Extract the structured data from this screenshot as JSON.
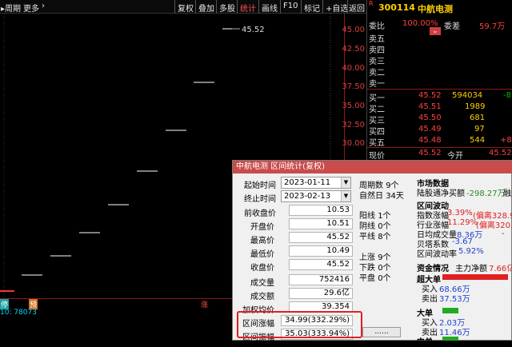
{
  "toolbar": {
    "left": [
      "周期",
      "更多",
      "›"
    ],
    "tabs": [
      "复权",
      "叠加",
      "多股",
      "统计",
      "画线",
      "F10",
      "标记",
      "+自选",
      "返回"
    ],
    "active_tab": "统计"
  },
  "chart": {
    "price_label": "45.52",
    "yticks": [
      "45.00",
      "42.50",
      "40.00",
      "37.50",
      "35.00",
      "32.50",
      "30.00"
    ],
    "markers": [
      "停",
      "预",
      "涨"
    ],
    "ma_text": "10: 78073"
  },
  "quote": {
    "code": "300114",
    "name": "中航电测",
    "r_badge": "R",
    "ratio_label": "委比",
    "ratio_value": "100.00%",
    "diff_label": "委差",
    "diff_value": "59.7万",
    "sell": [
      {
        "label": "卖五",
        "price": "",
        "vol": ""
      },
      {
        "label": "卖四",
        "price": "",
        "vol": ""
      },
      {
        "label": "卖三",
        "price": "",
        "vol": ""
      },
      {
        "label": "卖二",
        "price": "",
        "vol": ""
      },
      {
        "label": "卖一",
        "price": "",
        "vol": ""
      }
    ],
    "buy": [
      {
        "label": "买一",
        "price": "45.52",
        "vol": "594034",
        "extra": "-8"
      },
      {
        "label": "买二",
        "price": "45.51",
        "vol": "1989",
        "extra": ""
      },
      {
        "label": "买三",
        "price": "45.50",
        "vol": "681",
        "extra": ""
      },
      {
        "label": "买四",
        "price": "45.49",
        "vol": "97",
        "extra": ""
      },
      {
        "label": "买五",
        "price": "45.48",
        "vol": "544",
        "extra": "+8"
      }
    ],
    "now_label": "现价",
    "now_value": "45.52",
    "open_label": "今开",
    "open_value": "45.52"
  },
  "dialog": {
    "title": "中航电测 区间统计(复权)",
    "start_label": "起始时间",
    "start_value": "2023-01-11",
    "end_label": "终止时间",
    "end_value": "2023-02-13",
    "rows": [
      {
        "label": "前收盘价",
        "value": "10.53"
      },
      {
        "label": "开盘价",
        "value": "10.51"
      },
      {
        "label": "最高价",
        "value": "45.52"
      },
      {
        "label": "最低价",
        "value": "10.49"
      },
      {
        "label": "收盘价",
        "value": "45.52"
      },
      {
        "label": "成交量",
        "value": "752416"
      },
      {
        "label": "成交额",
        "value": "29.6亿"
      },
      {
        "label": "加权均价",
        "value": "39.354"
      },
      {
        "label": "区间涨幅",
        "value": "34.99(332.29%)"
      },
      {
        "label": "区间振幅",
        "value": "35.03(333.94%)"
      }
    ],
    "mid": [
      {
        "label": "周期数",
        "value": "9个"
      },
      {
        "label": "自然日",
        "value": "34天"
      },
      {
        "label": "阳线",
        "value": "1个"
      },
      {
        "label": "阴线",
        "value": "0个"
      },
      {
        "label": "平线",
        "value": "8个"
      },
      {
        "label": "上涨",
        "value": "9个"
      },
      {
        "label": "下跌",
        "value": "0个"
      },
      {
        "label": "平盘",
        "value": "0个"
      }
    ],
    "dots_button": "......",
    "market": {
      "title": "市场数据",
      "lugutong": "陆股通净买额",
      "lugutong_val": "-298.27万",
      "lugutong_tail": "融",
      "wave_title": "区间波动",
      "idx_label": "指数涨幅",
      "idx_val": "3.39%",
      "idx_dev": "(偏离328.9",
      "ind_label": "行业涨幅",
      "ind_val": "11.29%",
      "ind_dev": "(偏离320.9",
      "turn_label": "日均成交量",
      "turn_val": "8.36万",
      "beta_label": "贝塔系数",
      "beta_val": "-3.67",
      "vol_label": "区间波动率",
      "vol_val": "5.92%",
      "fund_title": "资金情况",
      "main_label": "主力净额",
      "main_val": "7.66亿",
      "super_label": "超大单",
      "super_buy_label": "买入",
      "super_buy": "68.66万",
      "super_sell_label": "卖出",
      "super_sell": "37.53万",
      "big_label": "大单",
      "big_buy_label": "买入",
      "big_buy": "2.03万",
      "big_sell_label": "卖出",
      "big_sell": "11.46万",
      "mid_label": "中单"
    }
  }
}
